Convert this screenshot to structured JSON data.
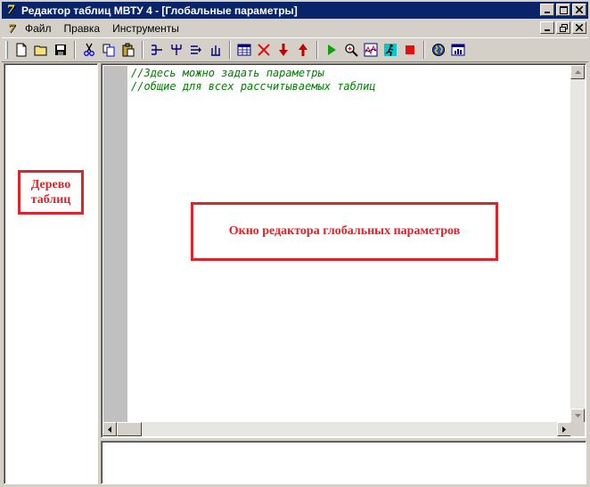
{
  "window": {
    "title": "Редактор таблиц МВТУ 4 - [Глобальные параметры]",
    "app_icon_glyph": "§"
  },
  "menu": {
    "items": [
      "Файл",
      "Правка",
      "Инструменты"
    ]
  },
  "toolbar": {
    "buttons": [
      {
        "name": "new-file-icon"
      },
      {
        "name": "open-folder-icon"
      },
      {
        "name": "save-icon"
      },
      {
        "name": "cut-icon"
      },
      {
        "name": "copy-icon"
      },
      {
        "name": "paste-icon"
      },
      {
        "name": "tree-collapse-icon"
      },
      {
        "name": "tree-expand-icon"
      },
      {
        "name": "tree-right-icon"
      },
      {
        "name": "tree-up-icon"
      },
      {
        "name": "table-icon"
      },
      {
        "name": "delete-icon"
      },
      {
        "name": "move-down-icon"
      },
      {
        "name": "move-up-icon"
      },
      {
        "name": "run-icon"
      },
      {
        "name": "zoom-icon"
      },
      {
        "name": "graph-icon"
      },
      {
        "name": "runner-icon"
      },
      {
        "name": "stop-icon"
      },
      {
        "name": "globe-icon"
      },
      {
        "name": "chart-window-icon"
      }
    ]
  },
  "editor": {
    "lines": [
      "//Здесь можно задать параметры",
      "//общие для всех рассчитываемых таблиц"
    ]
  },
  "annotations": {
    "tree_label": "Дерево таблиц",
    "editor_label": "Окно редактора глобальных параметров"
  },
  "colors": {
    "titlebar": "#0a246a",
    "comment_text": "#008000",
    "annotation": "#d9252b"
  }
}
